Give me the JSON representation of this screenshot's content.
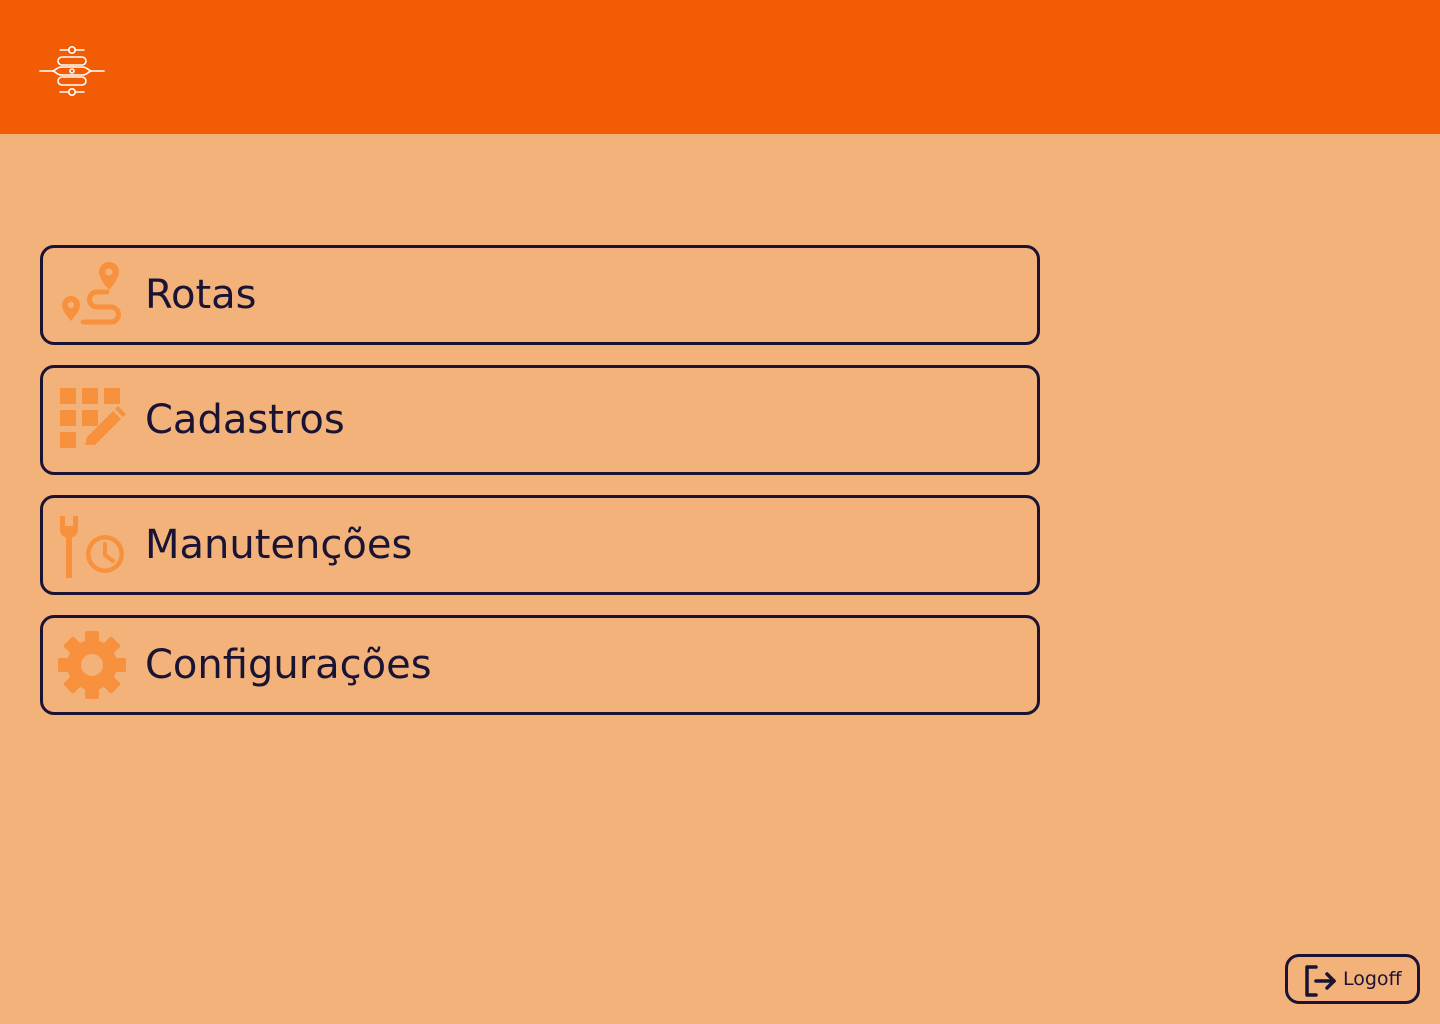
{
  "colors": {
    "header_bg": "#F25C05",
    "page_bg": "#F2B27A",
    "icon_accent": "#F7913D",
    "text_dark": "#1A1334",
    "logo_stroke": "#FFFFFF"
  },
  "header": {
    "logo_icon": "circuit-logo-icon"
  },
  "menu": {
    "items": [
      {
        "label": "Rotas",
        "icon": "route-pin-icon"
      },
      {
        "label": "Cadastros",
        "icon": "grid-edit-icon"
      },
      {
        "label": "Manutenções",
        "icon": "wrench-clock-icon"
      },
      {
        "label": "Configurações",
        "icon": "gear-icon"
      }
    ]
  },
  "logoff": {
    "label": "Logoff",
    "icon": "logout-icon"
  }
}
